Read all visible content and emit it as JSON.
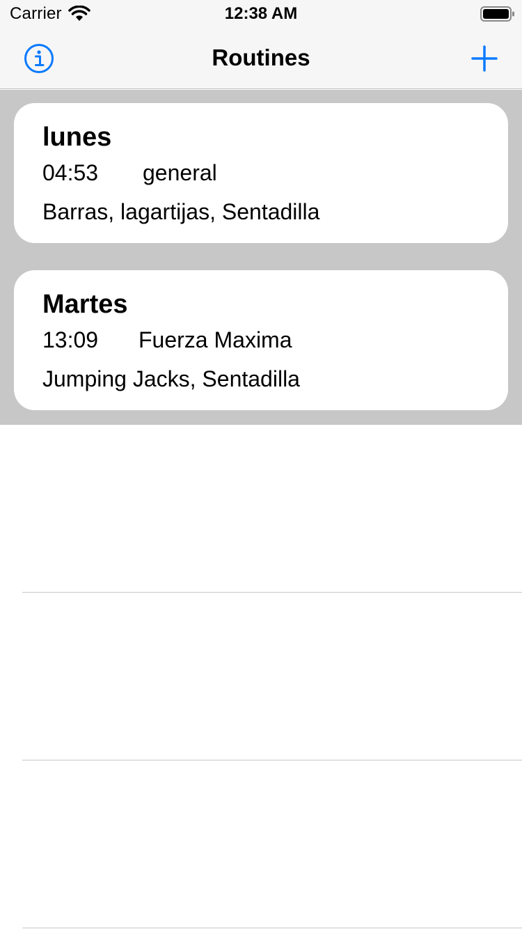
{
  "status_bar": {
    "carrier": "Carrier",
    "time": "12:38 AM",
    "wifi_icon": "wifi-icon",
    "battery_icon": "battery-icon"
  },
  "nav_bar": {
    "title": "Routines",
    "left_icon": "info-icon",
    "right_icon": "plus-icon",
    "accent_color": "#0a7aff"
  },
  "routines": [
    {
      "name": "lunes",
      "time": "04:53",
      "type": "general",
      "exercises": "Barras, lagartijas, Sentadilla"
    },
    {
      "name": "Martes",
      "time": "13:09",
      "type": "Fuerza Maxima",
      "exercises": "Jumping Jacks, Sentadilla"
    }
  ],
  "colors": {
    "row_background": "#c7c7c7",
    "card_background": "#ffffff",
    "bar_background": "#f6f6f6"
  }
}
